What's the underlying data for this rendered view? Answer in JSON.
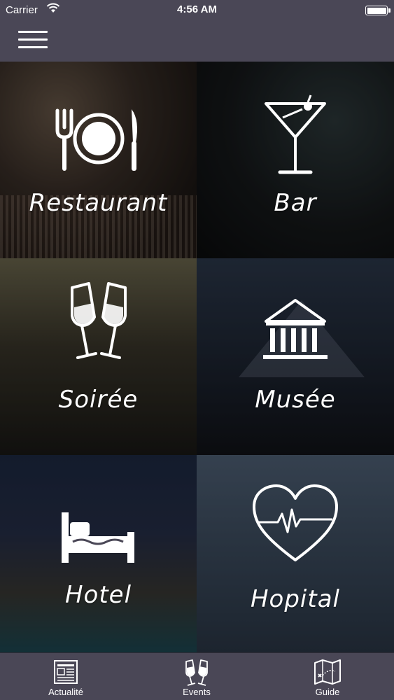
{
  "status_bar": {
    "carrier": "Carrier",
    "time": "4:56 AM"
  },
  "tiles": [
    {
      "label": "Restaurant",
      "icon": "fork-plate-knife-icon"
    },
    {
      "label": "Bar",
      "icon": "cocktail-icon"
    },
    {
      "label": "Soirée",
      "icon": "champagne-glasses-icon"
    },
    {
      "label": "Musée",
      "icon": "museum-icon"
    },
    {
      "label": "Hotel",
      "icon": "bed-icon"
    },
    {
      "label": "Hopital",
      "icon": "heartbeat-icon"
    }
  ],
  "tab_bar": {
    "items": [
      {
        "label": "Actualité",
        "icon": "newspaper-icon"
      },
      {
        "label": "Events",
        "icon": "champagne-glasses-icon"
      },
      {
        "label": "Guide",
        "icon": "map-icon"
      }
    ]
  },
  "colors": {
    "bar_background": "#4a4756",
    "text": "#ffffff"
  }
}
